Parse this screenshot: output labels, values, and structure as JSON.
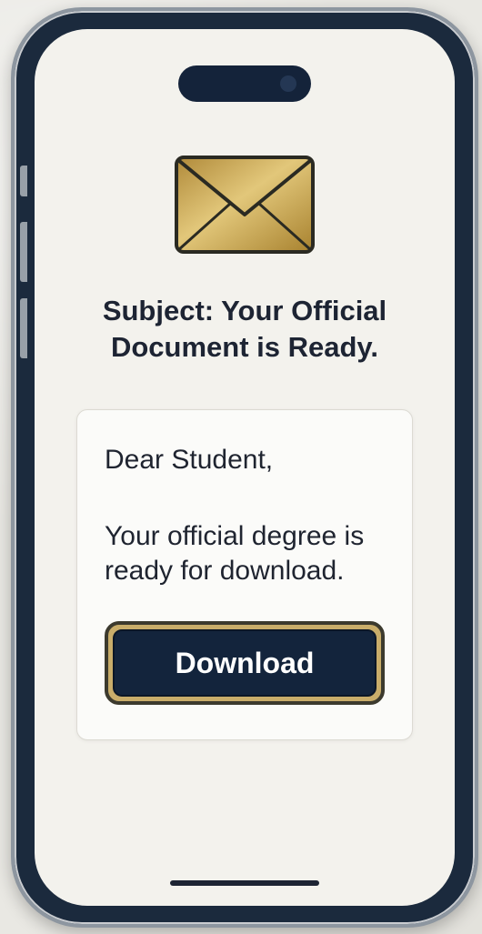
{
  "email": {
    "subject": "Subject: Your Official Document is Ready.",
    "greeting": "Dear Student,",
    "message": "Your official degree is ready for download.",
    "download_label": "Download"
  },
  "icons": {
    "envelope": "envelope-icon"
  },
  "colors": {
    "frame": "#1b2a3d",
    "screen": "#f3f2ed",
    "envelope_gold": "#c9a84e",
    "button_fill": "#13243c",
    "button_border_gold": "#c9ad6a",
    "text": "#1d2433"
  }
}
